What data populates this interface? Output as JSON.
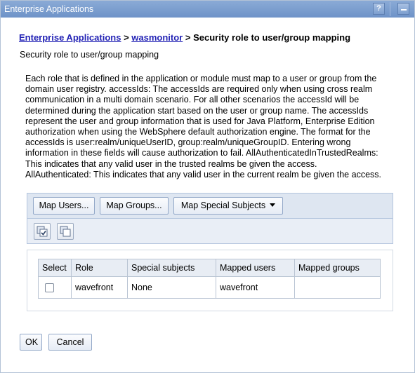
{
  "titlebar": {
    "title": "Enterprise Applications",
    "help_label": "?"
  },
  "breadcrumb": {
    "link1": "Enterprise Applications",
    "sep": ">",
    "link2": "wasmonitor",
    "current": "Security role to user/group mapping"
  },
  "page_subtitle": "Security role to user/group mapping",
  "description": "Each role that is defined in the application or module must map to a user or group from the domain user registry. accessIds: The accessIds are required only when using cross realm communication in a multi domain scenario. For all other scenarios the accessId will be determined during the application start based on the user or group name. The accessIds represent the user and group information that is used for Java Platform, Enterprise Edition authorization when using the WebSphere default authorization engine. The format for the accessIds is user:realm/uniqueUserID, group:realm/uniqueGroupID. Entering wrong information in these fields will cause authorization to fail. AllAuthenticatedInTrustedRealms: This indicates that any valid user in the trusted realms be given the access. AllAuthenticated: This indicates that any valid user in the current realm be given the access.",
  "toolbar": {
    "map_users": "Map Users...",
    "map_groups": "Map Groups...",
    "map_special": "Map Special Subjects"
  },
  "icons": {
    "select_all": "select-all-icon",
    "deselect_all": "deselect-all-icon"
  },
  "table": {
    "headers": [
      "Select",
      "Role",
      "Special subjects",
      "Mapped users",
      "Mapped groups"
    ],
    "rows": [
      {
        "selected": false,
        "role": "wavefront",
        "special": "None",
        "users": "wavefront",
        "groups": ""
      }
    ]
  },
  "buttons": {
    "ok": "OK",
    "cancel": "Cancel"
  }
}
